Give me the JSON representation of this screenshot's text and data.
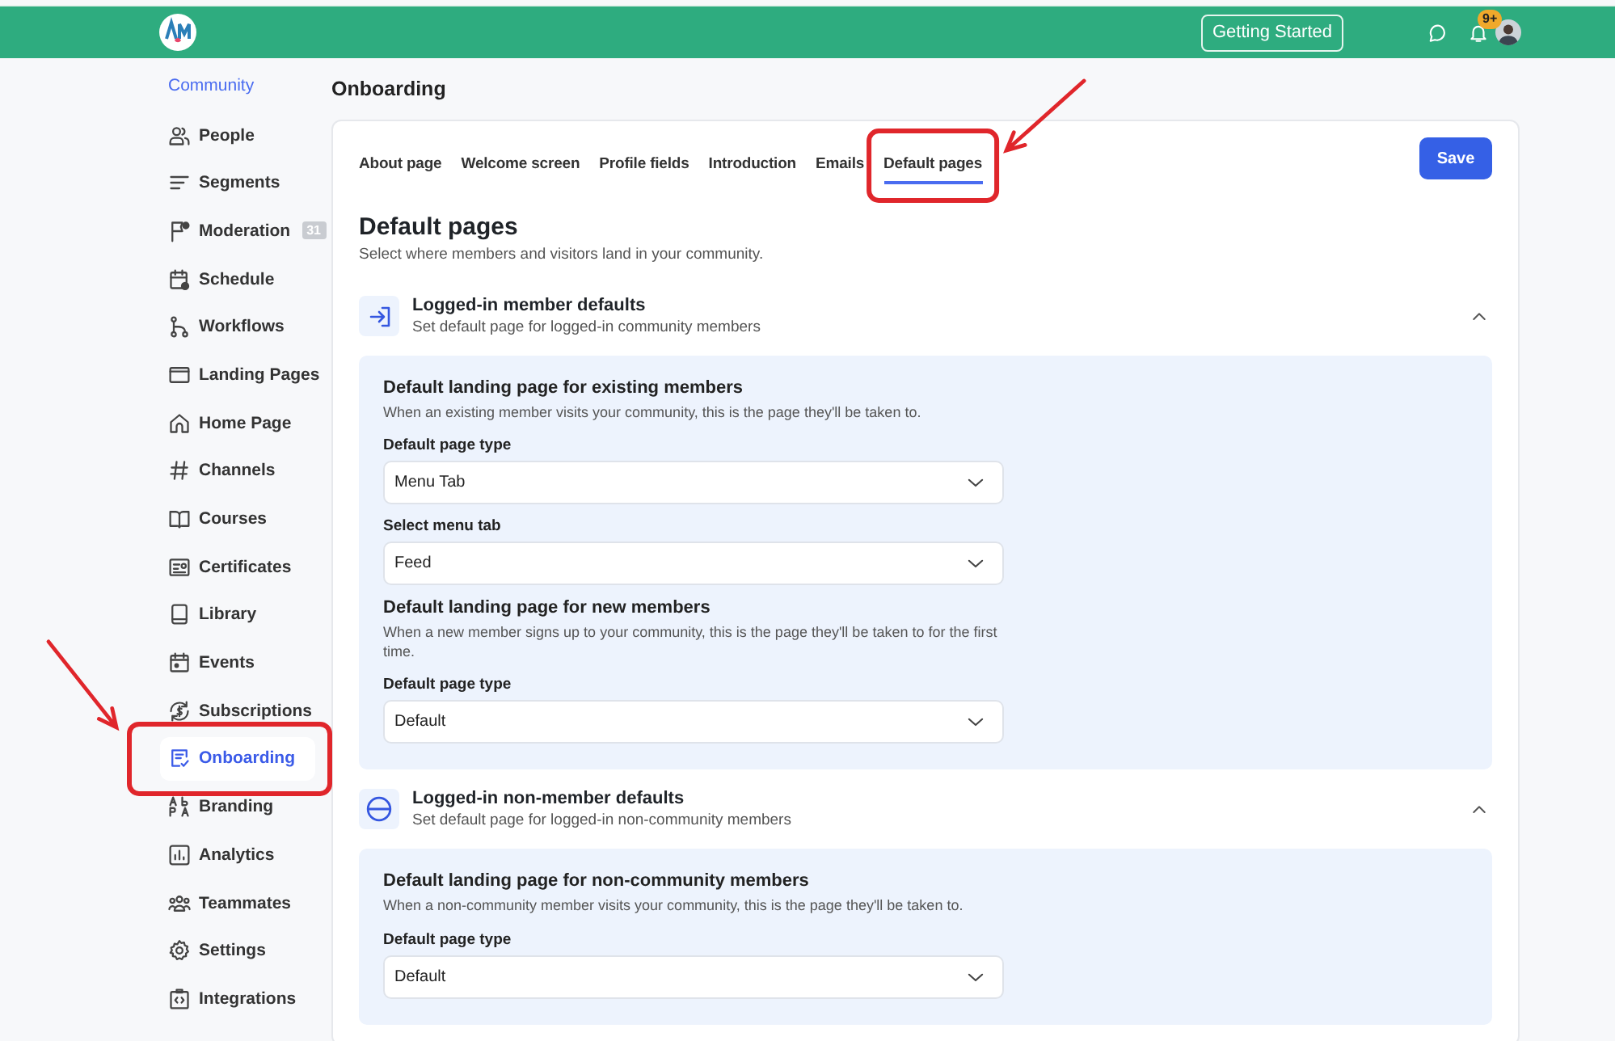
{
  "topbar": {
    "getting_started": "Getting Started",
    "notification_badge": "9+"
  },
  "sidebar": {
    "heading": "Community",
    "items": [
      {
        "label": "People",
        "selected": false
      },
      {
        "label": "Segments",
        "selected": false
      },
      {
        "label": "Moderation",
        "selected": false,
        "badge": "31"
      },
      {
        "label": "Schedule",
        "selected": false
      },
      {
        "label": "Workflows",
        "selected": false
      },
      {
        "label": "Landing Pages",
        "selected": false
      },
      {
        "label": "Home Page",
        "selected": false
      },
      {
        "label": "Channels",
        "selected": false
      },
      {
        "label": "Courses",
        "selected": false
      },
      {
        "label": "Certificates",
        "selected": false
      },
      {
        "label": "Library",
        "selected": false
      },
      {
        "label": "Events",
        "selected": false
      },
      {
        "label": "Subscriptions",
        "selected": false
      },
      {
        "label": "Onboarding",
        "selected": true
      },
      {
        "label": "Branding",
        "selected": false
      },
      {
        "label": "Analytics",
        "selected": false
      },
      {
        "label": "Teammates",
        "selected": false
      },
      {
        "label": "Settings",
        "selected": false
      },
      {
        "label": "Integrations",
        "selected": false
      }
    ]
  },
  "page_title": "Onboarding",
  "tabs": [
    {
      "label": "About page",
      "selected": false
    },
    {
      "label": "Welcome screen",
      "selected": false
    },
    {
      "label": "Profile fields",
      "selected": false
    },
    {
      "label": "Introduction",
      "selected": false
    },
    {
      "label": "Emails",
      "selected": false
    },
    {
      "label": "Default pages",
      "selected": true
    }
  ],
  "save_button": "Save",
  "heading": "Default pages",
  "subheading": "Select where members and visitors land in your community.",
  "sections": [
    {
      "kind": "login",
      "title": "Logged-in member defaults",
      "subtitle": "Set default page for logged-in community members",
      "expanded": true,
      "groups": [
        {
          "heading": "Default landing page for existing members",
          "description": "When an existing member visits your community, this is the page they'll be taken to.",
          "fields": [
            {
              "label": "Default page type",
              "value": "Menu Tab"
            },
            {
              "label": "Select menu tab",
              "value": "Feed"
            }
          ]
        },
        {
          "heading": "Default landing page for new members",
          "description": "When a new member signs up to your community, this is the page they'll be taken to for the first time.",
          "fields": [
            {
              "label": "Default page type",
              "value": "Default"
            }
          ]
        }
      ]
    },
    {
      "kind": "non-member",
      "title": "Logged-in non-member defaults",
      "subtitle": "Set default page for logged-in non-community members",
      "expanded": true,
      "groups": [
        {
          "heading": "Default landing page for non-community members",
          "description": "When a non-community member visits your community, this is the page they'll be taken to.",
          "fields": [
            {
              "label": "Default page type",
              "value": "Default"
            }
          ]
        }
      ]
    }
  ],
  "callouts": {
    "tab_highlighted": true,
    "sidebar_highlighted": true
  }
}
